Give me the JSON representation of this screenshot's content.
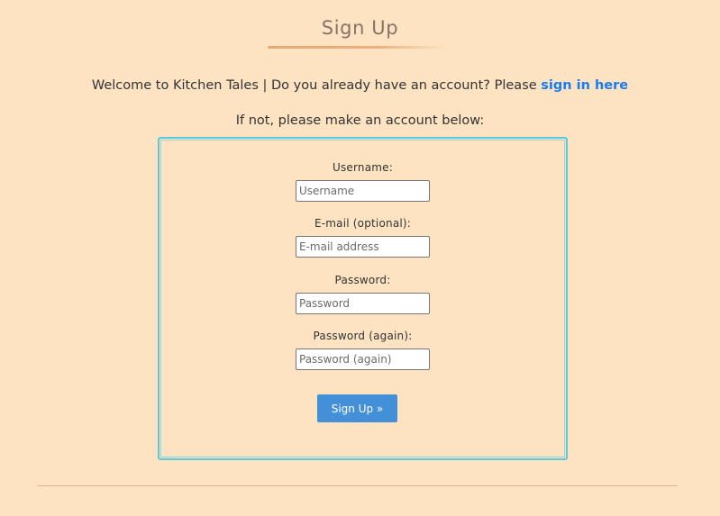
{
  "page": {
    "title": "Sign Up",
    "welcome_text": "Welcome to Kitchen Tales | Do you already have an account? Please ",
    "signin_link_label": "sign in here",
    "account_prompt": "If not, please make an account below:"
  },
  "form": {
    "fields": [
      {
        "label": "Username:",
        "placeholder": "Username",
        "value": ""
      },
      {
        "label": "E-mail (optional):",
        "placeholder": "E-mail address",
        "value": ""
      },
      {
        "label": "Password:",
        "placeholder": "Password",
        "value": ""
      },
      {
        "label": "Password (again):",
        "placeholder": "Password (again)",
        "value": ""
      }
    ],
    "submit_label": "Sign Up »"
  },
  "colors": {
    "background": "#fde3c2",
    "link": "#1a7cf2",
    "button": "#4390d9",
    "form_border": "#5ec8d8",
    "title": "#8a7266"
  }
}
